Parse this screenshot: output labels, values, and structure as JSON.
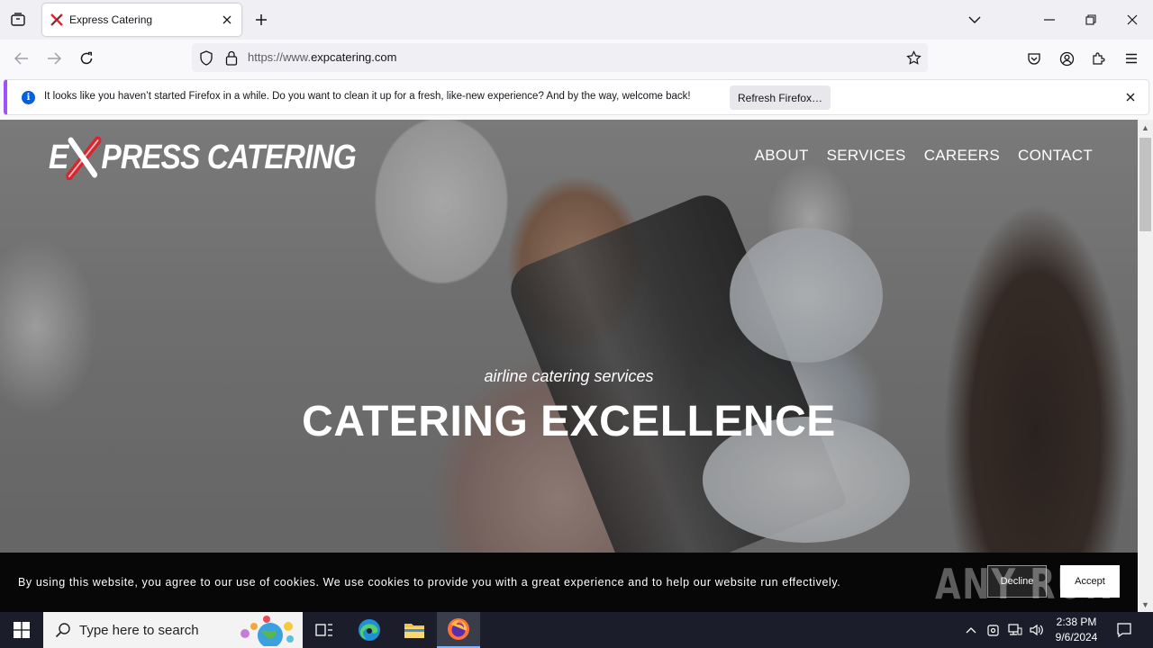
{
  "browser": {
    "tab": {
      "title": "Express Catering"
    },
    "url": {
      "prefix": "https://www.",
      "domain": "expcatering.com"
    },
    "notification": {
      "text": "It looks like you haven’t started Firefox in a while. Do you want to clean it up for a fresh, like-new experience? And by the way, welcome back!",
      "button_label": "Refresh Firefox…"
    }
  },
  "site": {
    "logo": {
      "pre": "E",
      "post": "PRESS CATERING"
    },
    "nav": [
      {
        "label": "ABOUT"
      },
      {
        "label": "SERVICES"
      },
      {
        "label": "CAREERS"
      },
      {
        "label": "CONTACT"
      }
    ],
    "hero": {
      "subtitle": "airline catering services",
      "title": "CATERING EXCELLENCE"
    },
    "cookie": {
      "text": "By using this website, you agree to our use of cookies. We use cookies to provide you with a great experience and to help our website run effectively.",
      "decline_label": "Decline",
      "accept_label": "Accept"
    },
    "watermark": "ANY RUN"
  },
  "taskbar": {
    "search_placeholder": "Type here to search",
    "time": "2:38 PM",
    "date": "9/6/2024"
  },
  "colors": {
    "accent_brand": "#d7262e",
    "notification_border": "#a052ff",
    "info_blue": "#0060df"
  }
}
